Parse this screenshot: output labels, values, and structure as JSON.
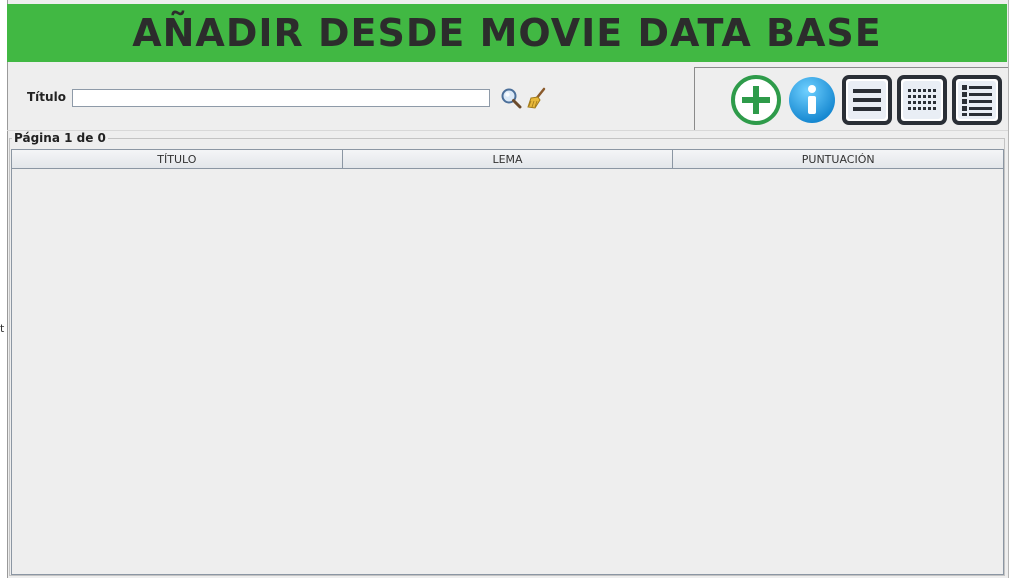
{
  "header": {
    "title": "AÑADIR DESDE MOVIE DATA BASE"
  },
  "search": {
    "label": "Título",
    "value": "",
    "search_icon": "magnifier-icon",
    "clear_icon": "broom-icon"
  },
  "actions": [
    {
      "icon": "add-circle-icon"
    },
    {
      "icon": "info-icon"
    },
    {
      "icon": "list-view-icon"
    },
    {
      "icon": "grid-view-icon"
    },
    {
      "icon": "detail-view-icon"
    }
  ],
  "results": {
    "page_label": "Página 1 de 0",
    "columns": [
      "TÍTULO",
      "LEMA",
      "PUNTUACIÓN"
    ],
    "rows": []
  },
  "colors": {
    "banner": "#41b843",
    "title_text": "#2c2c2c",
    "add": "#2e9b4a",
    "info": "#1ba0e0",
    "view_buttons": "#2a2f36"
  }
}
